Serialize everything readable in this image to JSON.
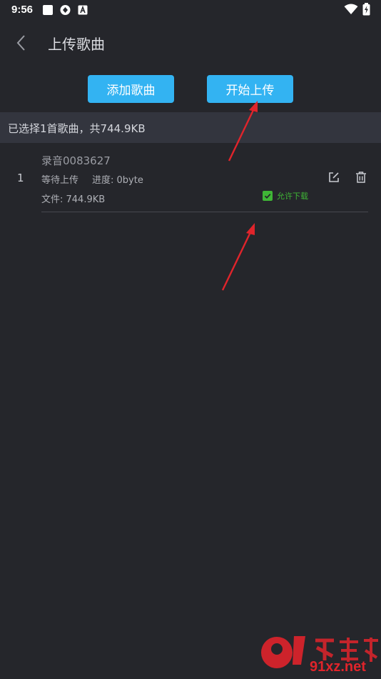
{
  "status_bar": {
    "time": "9:56"
  },
  "header": {
    "title": "上传歌曲"
  },
  "actions": {
    "add_label": "添加歌曲",
    "upload_label": "开始上传"
  },
  "summary": {
    "text": "已选择1首歌曲，共744.9KB"
  },
  "songs": [
    {
      "index": "1",
      "name": "录音0083627",
      "status": "等待上传",
      "progress": "进度: 0byte",
      "file": "文件: 744.9KB",
      "allow_download_label": "允许下载",
      "allow_download": true
    }
  ],
  "watermark": {
    "text": "91xz.net"
  },
  "colors": {
    "background": "#25262b",
    "accent": "#33b3f2",
    "summary_bg": "#33353e",
    "check_green": "#3fb536",
    "annotation_red": "#e0242b"
  }
}
